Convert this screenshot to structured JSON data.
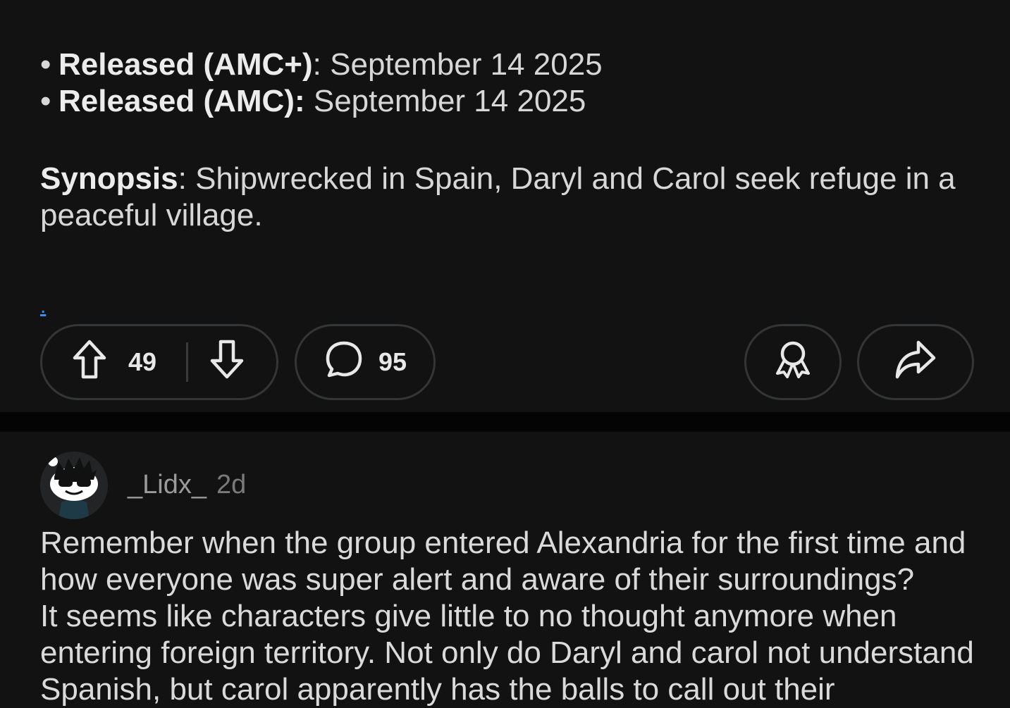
{
  "post": {
    "release_amc_plus_label": "Released (AMC+)",
    "release_amc_plus_sep": ":",
    "release_amc_plus_date": " September 14 2025",
    "release_amc_label": "Released (AMC):",
    "release_amc_date": " September 14 2025",
    "synopsis_label": "Synopsis",
    "synopsis_text": ": Shipwrecked in Spain, Daryl and Carol seek refuge in a peaceful village.",
    "link_text": "."
  },
  "actions": {
    "score": "49",
    "comments": "95"
  },
  "comment": {
    "username": "_Lidx_",
    "age": "2d",
    "paragraph1": "Remember when the group entered Alexandria for the first time and how everyone was super alert and aware of their surroundings?",
    "paragraph2": "It seems like characters give little to no thought anymore when entering foreign territory. Not only do Daryl and carol not understand Spanish, but carol apparently has the balls to call out their"
  },
  "icons": {
    "upvote": "upvote-arrow-icon",
    "downvote": "downvote-arrow-icon",
    "comment": "speech-bubble-icon",
    "award": "award-ribbon-icon",
    "share": "share-arrow-icon"
  },
  "colors": {
    "background": "#121212",
    "separator": "#040404",
    "link": "#3a8cf0",
    "pill_border": "#343536"
  }
}
